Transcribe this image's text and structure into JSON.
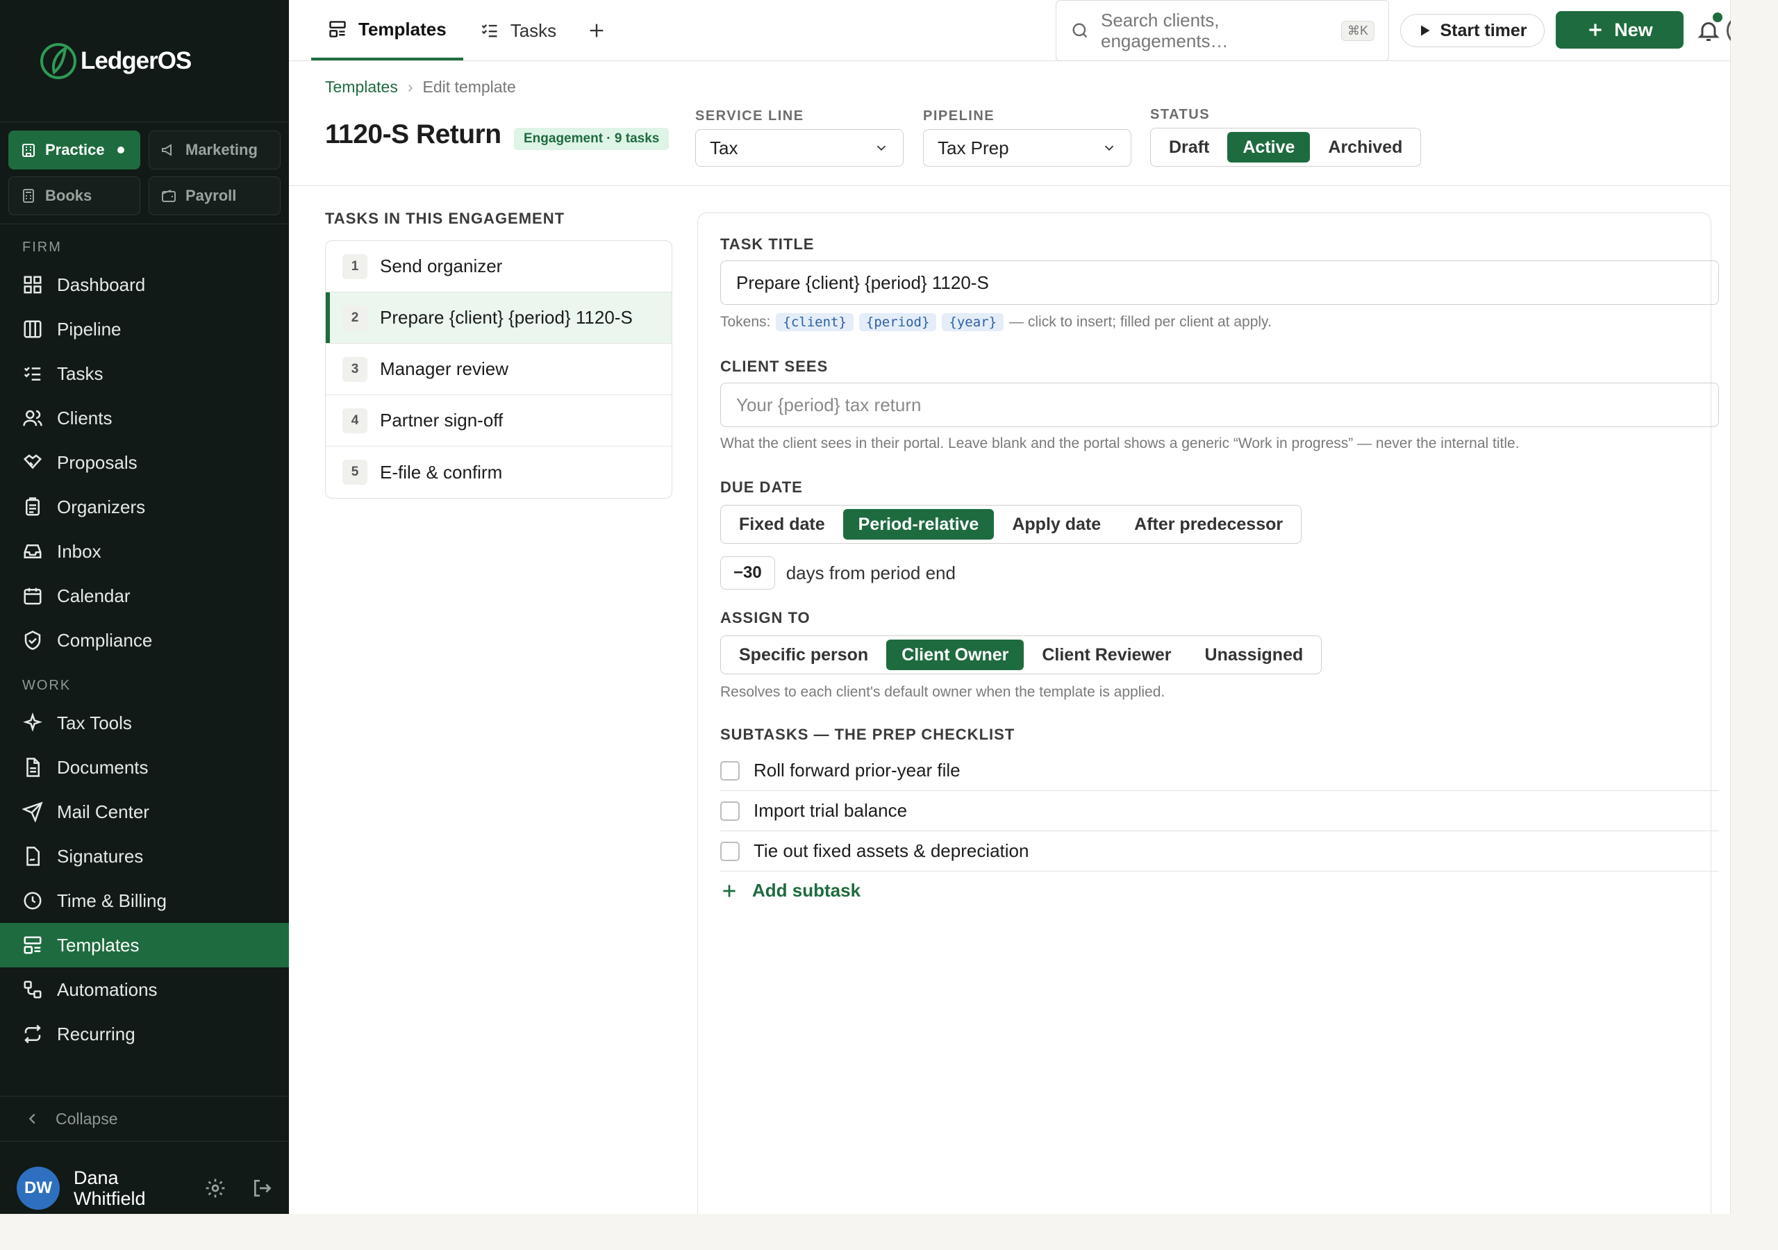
{
  "brand": {
    "name": "LedgerOS"
  },
  "workspaces": [
    {
      "label": "Practice",
      "active": true,
      "icon": "building-icon"
    },
    {
      "label": "Marketing",
      "active": false,
      "icon": "megaphone-icon"
    },
    {
      "label": "Books",
      "active": false,
      "icon": "calculator-icon"
    },
    {
      "label": "Payroll",
      "active": false,
      "icon": "wallet-icon"
    }
  ],
  "sidebar": {
    "firm_heading": "FIRM",
    "work_heading": "WORK",
    "firm_items": [
      {
        "label": "Dashboard",
        "icon": "grid-icon"
      },
      {
        "label": "Pipeline",
        "icon": "columns-icon"
      },
      {
        "label": "Tasks",
        "icon": "checklist-icon"
      },
      {
        "label": "Clients",
        "icon": "users-icon"
      },
      {
        "label": "Proposals",
        "icon": "handshake-icon"
      },
      {
        "label": "Organizers",
        "icon": "clipboard-icon"
      },
      {
        "label": "Inbox",
        "icon": "inbox-icon"
      },
      {
        "label": "Calendar",
        "icon": "calendar-icon"
      },
      {
        "label": "Compliance",
        "icon": "shield-check-icon"
      }
    ],
    "work_items": [
      {
        "label": "Tax Tools",
        "icon": "sparkle-icon"
      },
      {
        "label": "Documents",
        "icon": "document-icon"
      },
      {
        "label": "Mail Center",
        "icon": "send-icon"
      },
      {
        "label": "Signatures",
        "icon": "signature-icon"
      },
      {
        "label": "Time & Billing",
        "icon": "clock-icon"
      },
      {
        "label": "Templates",
        "icon": "template-icon",
        "active": true
      },
      {
        "label": "Automations",
        "icon": "workflow-icon"
      },
      {
        "label": "Recurring",
        "icon": "repeat-icon"
      }
    ],
    "collapse_label": "Collapse",
    "user": {
      "initials": "DW",
      "name": "Dana Whitfield"
    }
  },
  "topbar": {
    "tabs": [
      {
        "label": "Templates",
        "active": true
      },
      {
        "label": "Tasks",
        "active": false
      }
    ],
    "search_placeholder": "Search clients, engagements…",
    "search_shortcut": "⌘K",
    "timer_label": "Start timer",
    "new_label": "New"
  },
  "header": {
    "breadcrumb_root": "Templates",
    "breadcrumb_current": "Edit template",
    "title": "1120-S Return",
    "badge": "Engagement · 9 tasks",
    "service_line_label": "SERVICE LINE",
    "service_line_value": "Tax",
    "pipeline_label": "PIPELINE",
    "pipeline_value": "Tax Prep",
    "status_label": "STATUS",
    "status_options": [
      "Draft",
      "Active",
      "Archived"
    ],
    "status_selected": "Active"
  },
  "tasks_panel": {
    "heading": "TASKS IN THIS ENGAGEMENT",
    "tasks": [
      {
        "num": "1",
        "label": "Send organizer"
      },
      {
        "num": "2",
        "label": "Prepare {client} {period} 1120-S",
        "selected": true
      },
      {
        "num": "3",
        "label": "Manager review"
      },
      {
        "num": "4",
        "label": "Partner sign-off"
      },
      {
        "num": "5",
        "label": "E-file & confirm"
      }
    ]
  },
  "editor": {
    "task_title_label": "TASK TITLE",
    "task_title_value": "Prepare {client} {period} 1120-S",
    "tokens_label": "Tokens:",
    "tokens": [
      "{client}",
      "{period}",
      "{year}"
    ],
    "tokens_hint": "— click to insert; filled per client at apply.",
    "client_sees_label": "CLIENT SEES",
    "client_sees_placeholder": "Your {period} tax return",
    "client_sees_hint": "What the client sees in their portal. Leave blank and the portal shows a generic “Work in progress” — never the internal title.",
    "due_date_label": "DUE DATE",
    "due_date_options": [
      "Fixed date",
      "Period-relative",
      "Apply date",
      "After predecessor"
    ],
    "due_date_selected": "Period-relative",
    "due_offset": "−30",
    "due_offset_suffix": "days from period end",
    "assign_label": "ASSIGN TO",
    "assign_options": [
      "Specific person",
      "Client Owner",
      "Client Reviewer",
      "Unassigned"
    ],
    "assign_selected": "Client Owner",
    "assign_hint": "Resolves to each client's default owner when the template is applied.",
    "subtasks_label": "SUBTASKS — THE PREP CHECKLIST",
    "subtasks": [
      {
        "label": "Roll forward prior-year file",
        "checked": false
      },
      {
        "label": "Import trial balance",
        "checked": false
      },
      {
        "label": "Tie out fixed assets & depreciation",
        "checked": false
      }
    ],
    "add_subtask_label": "Add subtask"
  },
  "colors": {
    "accent": "#1e6b3f",
    "sidebar_bg": "#111a16",
    "token_bg": "#e4edf8"
  }
}
